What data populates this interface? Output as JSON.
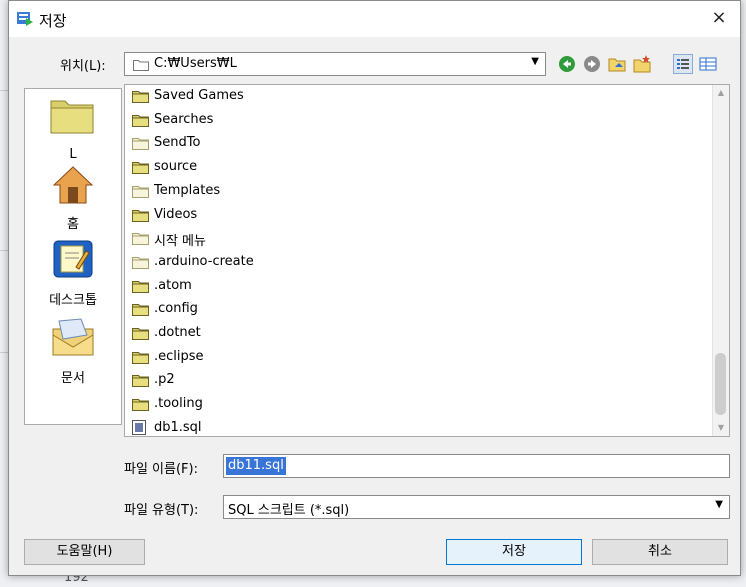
{
  "dialog": {
    "title": "저장",
    "close": "×"
  },
  "location": {
    "label": "위치(L):",
    "path": "C:₩Users₩L"
  },
  "toolbar": {
    "icons": [
      "back-icon",
      "forward-icon",
      "up-folder-icon",
      "new-folder-icon",
      "list-view-icon",
      "details-view-icon"
    ]
  },
  "places": [
    {
      "label": "L",
      "icon": "user-folder-icon"
    },
    {
      "label": "홈",
      "icon": "home-icon"
    },
    {
      "label": "데스크톱",
      "icon": "desktop-icon"
    },
    {
      "label": "문서",
      "icon": "documents-icon"
    }
  ],
  "files": [
    {
      "name": "Saved Games",
      "type": "folder"
    },
    {
      "name": "Searches",
      "type": "folder"
    },
    {
      "name": "SendTo",
      "type": "folder-light"
    },
    {
      "name": "source",
      "type": "folder"
    },
    {
      "name": "Templates",
      "type": "folder-light"
    },
    {
      "name": "Videos",
      "type": "folder"
    },
    {
      "name": "시작 메뉴",
      "type": "folder-light"
    },
    {
      "name": ".arduino-create",
      "type": "folder-light"
    },
    {
      "name": ".atom",
      "type": "folder"
    },
    {
      "name": ".config",
      "type": "folder"
    },
    {
      "name": ".dotnet",
      "type": "folder"
    },
    {
      "name": ".eclipse",
      "type": "folder"
    },
    {
      "name": ".p2",
      "type": "folder"
    },
    {
      "name": ".tooling",
      "type": "folder"
    },
    {
      "name": "db1.sql",
      "type": "file"
    }
  ],
  "filename": {
    "label": "파일 이름(F):",
    "value": "db11.sql"
  },
  "filetype": {
    "label": "파일 유형(T):",
    "value": "SQL 스크립트 (*.sql)"
  },
  "buttons": {
    "help": "도움말(H)",
    "save": "저장",
    "cancel": "취소"
  },
  "background": {
    "line_number": "192"
  }
}
